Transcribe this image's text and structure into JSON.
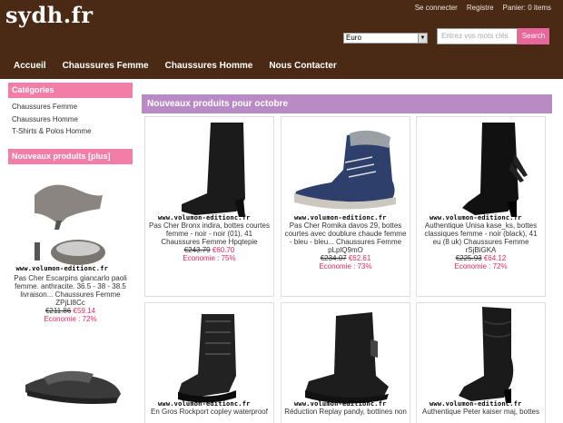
{
  "header": {
    "logo": "sydh.fr",
    "links": [
      "Se connecter",
      "Registre",
      "Panier: 0 items"
    ],
    "currency": "Euro",
    "search_placeholder": "Entrez vos mots clés",
    "search_button": "Search"
  },
  "nav": [
    "Accueil",
    "Chaussures Femme",
    "Chaussures Homme",
    "Nous Contacter"
  ],
  "sidebar": {
    "categories_title": "Catégories",
    "categories": [
      "Chaussures Femme",
      "Chaussures Homme",
      "T-Shirts & Polos Homme"
    ],
    "new_title": "Nouveaux produits  [plus]",
    "product": {
      "watermark": "www.volumon-editionc.fr",
      "title": "Pas Cher Escarpins giancarlo paoli femme. anthracite. 36.5 - 38 - 38.5 livraison... Chaussures Femme ZPjLl8Cc",
      "old_price": "€211.86",
      "new_price": "€59.14",
      "economy": "Economie : 72%"
    }
  },
  "main": {
    "title": "Nouveaux produits pour octobre",
    "products": [
      {
        "watermark": "www.volumon-editionc.fr",
        "title": "Pas Cher Bronx indira, bottes courtes femme - noir - noir (01), 41 Chaussures Femme Hpqtepie",
        "old_price": "€243.79",
        "new_price": "€60.70",
        "economy": "Economie : 75%"
      },
      {
        "watermark": "www.volumon-editionc.fr",
        "title": "Pas Cher Romika davos 29, bottes courtes avec doublure chaude femme - bleu - bleu... Chaussures Femme pLplQ9mO",
        "old_price": "€234.07",
        "new_price": "€62.61",
        "economy": "Economie : 73%"
      },
      {
        "watermark": "www.volumon-editionc.fr",
        "title": "Authentique Unisa kase_ks, bottes classiques femme - noir (black), 41 eu (8 uk) Chaussures Femme rSjBiGKA",
        "old_price": "€225.93",
        "new_price": "€64.12",
        "economy": "Economie : 72%"
      },
      {
        "watermark": "www.volumon-editionc.fr",
        "title": "En Gros Rockport copley waterproof"
      },
      {
        "watermark": "www.volumon-editionc.fr",
        "title": "Réduction Replay pandy, bottines non"
      },
      {
        "watermark": "www.volumon-editionc.fr",
        "title": "Authentique Peter kaiser maj, bottes"
      }
    ]
  }
}
